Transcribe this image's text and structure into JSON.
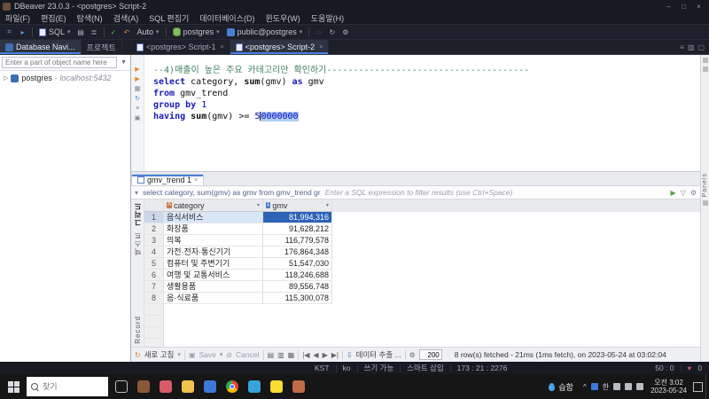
{
  "titlebar": {
    "title": "DBeaver 23.0.3 - <postgres> Script-2"
  },
  "menubar": {
    "items": [
      "파일(F)",
      "편집(E)",
      "탐색(N)",
      "검색(A)",
      "SQL 편집기",
      "데이터베이스(D)",
      "윈도우(W)",
      "도움말(H)"
    ]
  },
  "toolbar": {
    "sql_label": "SQL",
    "commit_mode": "Auto",
    "connection": "postgres",
    "schema": "public@postgres"
  },
  "sidebar": {
    "tab_navigator": "Database Navi...",
    "tab_projects": "프로젝트",
    "search_placeholder": "Enter a part of object name here",
    "tree_item": {
      "name": "postgres",
      "detail": "- localhost:5432"
    }
  },
  "editor": {
    "tabs": [
      {
        "label": "<postgres> Script-1"
      },
      {
        "label": "<postgres> Script-2"
      }
    ],
    "code": [
      {
        "segments": [
          {
            "t": "--4)매출이 높은 주요 카테고리만 확인하기--------------------------------------",
            "c": "comment"
          }
        ]
      },
      {
        "segments": [
          {
            "t": "select",
            "c": "kw"
          },
          {
            "t": " category, ",
            "c": "plain"
          },
          {
            "t": "sum",
            "c": "fn"
          },
          {
            "t": "(gmv) ",
            "c": "plain"
          },
          {
            "t": "as",
            "c": "kw"
          },
          {
            "t": " gmv",
            "c": "plain"
          }
        ]
      },
      {
        "segments": [
          {
            "t": "from",
            "c": "kw"
          },
          {
            "t": " gmv_trend",
            "c": "plain"
          }
        ]
      },
      {
        "segments": [
          {
            "t": "group by",
            "c": "kw"
          },
          {
            "t": " ",
            "c": "plain"
          },
          {
            "t": "1",
            "c": "num"
          }
        ]
      },
      {
        "current": true,
        "segments": [
          {
            "t": "having",
            "c": "kw"
          },
          {
            "t": " ",
            "c": "plain"
          },
          {
            "t": "sum",
            "c": "fn"
          },
          {
            "t": "(gmv) >= ",
            "c": "plain"
          },
          {
            "t": "5",
            "c": "num"
          },
          {
            "t": "0000000",
            "c": "num sel"
          }
        ]
      }
    ]
  },
  "results": {
    "tab_label": "gmv_trend 1",
    "rail_grid": "그리드",
    "rail_text": "텍스트",
    "rail_record": "Record",
    "filter_query": "select category, sum(gmv) as gmv from gmv_trend gr",
    "filter_placeholder": "Enter a SQL expression to filter results (use Ctrl+Space)",
    "columns": [
      "category",
      "gmv"
    ],
    "rows": [
      [
        "음식서비스",
        "81,994,316"
      ],
      [
        "화장품",
        "91,628,212"
      ],
      [
        "의복",
        "116,779,578"
      ],
      [
        "가전·전자·통신기기",
        "176,864,348"
      ],
      [
        "컴퓨터 및 주변기기",
        "51,547,030"
      ],
      [
        "여행 및 교통서비스",
        "118,246,688"
      ],
      [
        "생활용품",
        "89,556,748"
      ],
      [
        "음·식료품",
        "115,300,078"
      ]
    ],
    "selection": {
      "row_index": 0,
      "column": "gmv"
    },
    "toolbar": {
      "refresh": "새로 고침",
      "save": "Save",
      "cancel": "Cancel",
      "export": "데이터 추출 ...",
      "fetch_size": "200",
      "status": "8 row(s) fetched - 21ms (1ms fetch), on 2023-05-24 at 03:02:04"
    }
  },
  "right_rail": {
    "panels_label": "Panels"
  },
  "statusbar": {
    "timezone": "KST",
    "locale": "ko",
    "write_mode": "쓰기 가능",
    "insert_mode": "스마트 삽입",
    "caret_position": "173 : 21 : 2276",
    "selection_info": "50 : 0",
    "heart_count": "0"
  },
  "taskbar": {
    "search_placeholder": "찾기",
    "weather_label": "습함",
    "ime_indicator": "한",
    "time": "오전 3:02",
    "date": "2023-05-24",
    "app_icons": [
      {
        "name": "task-view-icon",
        "color": "#b8bcc2",
        "style": "outline"
      },
      {
        "name": "widgets-photo-icon",
        "color": "#8a5a36"
      },
      {
        "name": "mail-app-icon",
        "color": "#d95b6a"
      },
      {
        "name": "file-explorer-icon",
        "color": "#f2c14e"
      },
      {
        "name": "ms-store-icon",
        "color": "#3d79d6"
      },
      {
        "name": "chrome-icon",
        "color": "chrome"
      },
      {
        "name": "edge-icon",
        "color": "#35a3d8"
      },
      {
        "name": "kakaotalk-icon",
        "color": "#f8dd33"
      },
      {
        "name": "dbeaver-icon",
        "color": "#c06b4a"
      }
    ]
  }
}
